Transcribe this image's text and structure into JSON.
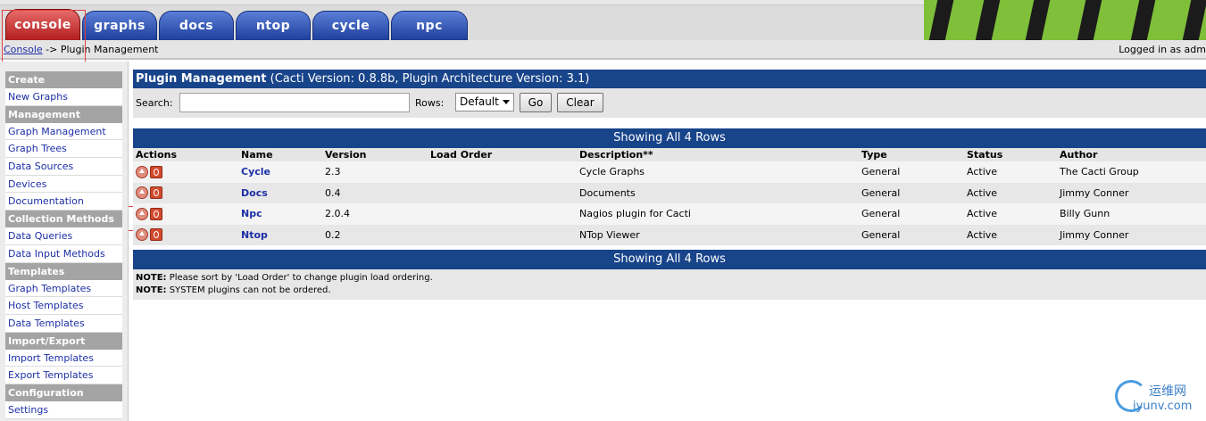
{
  "tabs": [
    {
      "label": "console",
      "active": true
    },
    {
      "label": "graphs",
      "active": false
    },
    {
      "label": "docs",
      "active": false
    },
    {
      "label": "ntop",
      "active": false
    },
    {
      "label": "cycle",
      "active": false
    },
    {
      "label": "npc",
      "active": false
    }
  ],
  "breadcrumb": {
    "root": "Console",
    "separator": " -> ",
    "current": "Plugin Management"
  },
  "login_status": "Logged in as adm",
  "sidebar": {
    "sections": [
      {
        "header": "Create",
        "items": [
          "New Graphs"
        ]
      },
      {
        "header": "Management",
        "items": [
          "Graph Management",
          "Graph Trees",
          "Data Sources",
          "Devices",
          "Documentation"
        ]
      },
      {
        "header": "Collection Methods",
        "items": [
          "Data Queries",
          "Data Input Methods"
        ]
      },
      {
        "header": "Templates",
        "items": [
          "Graph Templates",
          "Host Templates",
          "Data Templates"
        ]
      },
      {
        "header": "Import/Export",
        "items": [
          "Import Templates",
          "Export Templates"
        ]
      },
      {
        "header": "Configuration",
        "items": [
          "Settings"
        ]
      }
    ]
  },
  "page": {
    "title": "Plugin Management",
    "subtitle": "(Cacti Version: 0.8.8b, Plugin Architecture Version: 3.1)"
  },
  "filter": {
    "search_label": "Search:",
    "search_value": "",
    "rows_label": "Rows:",
    "rows_value": "Default",
    "go_label": "Go",
    "clear_label": "Clear"
  },
  "table": {
    "summary_top": "Showing All 4 Rows",
    "summary_bottom": "Showing All 4 Rows",
    "columns": [
      "Actions",
      "Name",
      "Version",
      "Load Order",
      "Description**",
      "Type",
      "Status",
      "Author"
    ],
    "rows": [
      {
        "name": "Cycle",
        "version": "2.3",
        "load_order": "",
        "description": "Cycle Graphs",
        "type": "General",
        "status": "Active",
        "author": "The Cacti Group"
      },
      {
        "name": "Docs",
        "version": "0.4",
        "load_order": "",
        "description": "Documents",
        "type": "General",
        "status": "Active",
        "author": "Jimmy Conner"
      },
      {
        "name": "Npc",
        "version": "2.0.4",
        "load_order": "",
        "description": "Nagios plugin for Cacti",
        "type": "General",
        "status": "Active",
        "author": "Billy Gunn"
      },
      {
        "name": "Ntop",
        "version": "0.2",
        "load_order": "",
        "description": "NTop Viewer",
        "type": "General",
        "status": "Active",
        "author": "Jimmy Conner"
      }
    ]
  },
  "notes": [
    {
      "label": "NOTE:",
      "text": " Please sort by 'Load Order' to change plugin load ordering."
    },
    {
      "label": "NOTE:",
      "text": " SYSTEM plugins can not be ordered."
    }
  ],
  "watermark": {
    "cn": "运维网",
    "en": "iyunv.com"
  },
  "colors": {
    "header_blue": "#18448a",
    "active_tab": "#b31e1e",
    "tab_blue": "#1f3f9c",
    "link": "#1d2fa6"
  }
}
